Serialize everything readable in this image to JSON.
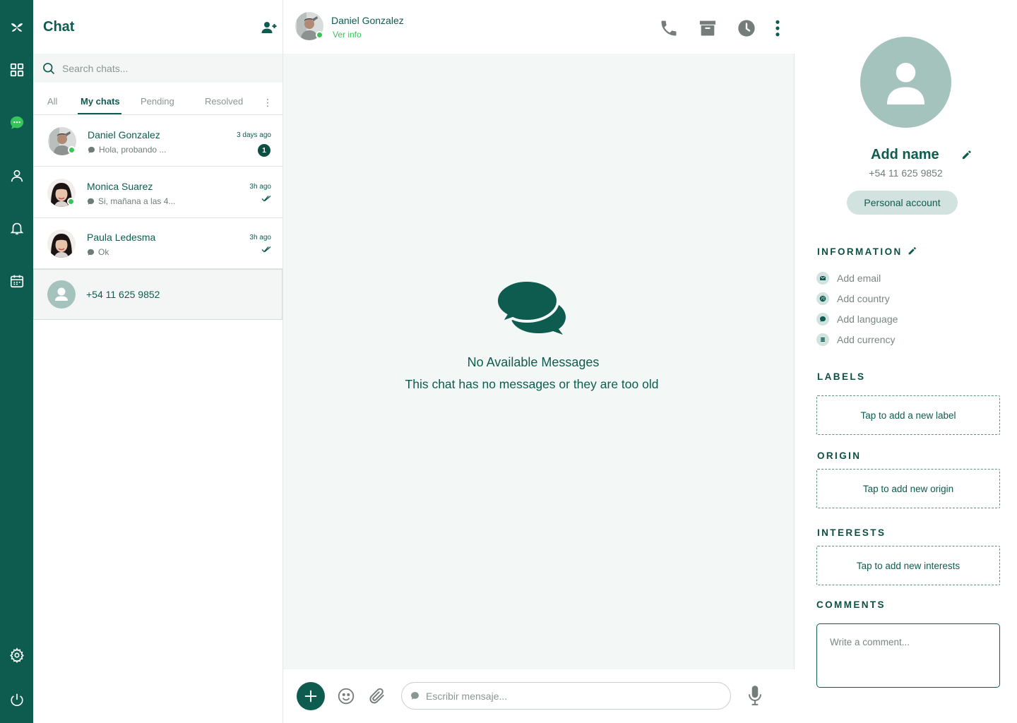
{
  "colors": {
    "brand": "#0d5c4f",
    "online": "#37c55a",
    "chip": "#d2e3df",
    "avatar_placeholder": "#a4c3bd"
  },
  "rail": {
    "items": [
      "logo-icon",
      "grid-icon",
      "chat-icon",
      "contacts-icon",
      "bell-icon",
      "calendar-icon",
      "settings-icon",
      "power-icon"
    ]
  },
  "list": {
    "title": "Chat",
    "search_placeholder": "Search chats...",
    "tabs": [
      "All",
      "My chats",
      "Pending",
      "Resolved"
    ],
    "active_tab": "My chats",
    "chats": [
      {
        "name": "Daniel Gonzalez",
        "preview": "Hola, probando ...",
        "time": "3 days ago",
        "unread": "1",
        "online": true
      },
      {
        "name": "Monica Suarez",
        "preview": "Si, mañana a las 4...",
        "time": "3h ago",
        "read": true,
        "online": true
      },
      {
        "name": "Paula Ledesma",
        "preview": "Ok",
        "time": "3h ago",
        "read": true,
        "online": false
      },
      {
        "name": "+54 11 625 9852",
        "selected": true
      }
    ]
  },
  "conversation": {
    "name": "Daniel Gonzalez",
    "sub": "Ver info",
    "empty_title": "No Available Messages",
    "empty_sub": "This chat has no messages or they are too old",
    "composer_placeholder": "Escribir mensaje..."
  },
  "profile": {
    "name": "Add name",
    "phone": "+54 11 625 9852",
    "account_type": "Personal account",
    "information_title": "INFORMATION",
    "information": [
      "Add email",
      "Add country",
      "Add language",
      "Add currency"
    ],
    "labels_title": "LABELS",
    "labels_cta": "Tap to add a new label",
    "origin_title": "ORIGIN",
    "origin_cta": "Tap to add new origin",
    "interests_title": "INTERESTS",
    "interests_cta": "Tap to add new interests",
    "comments_title": "COMMENTS",
    "comment_placeholder": "Write a comment..."
  }
}
